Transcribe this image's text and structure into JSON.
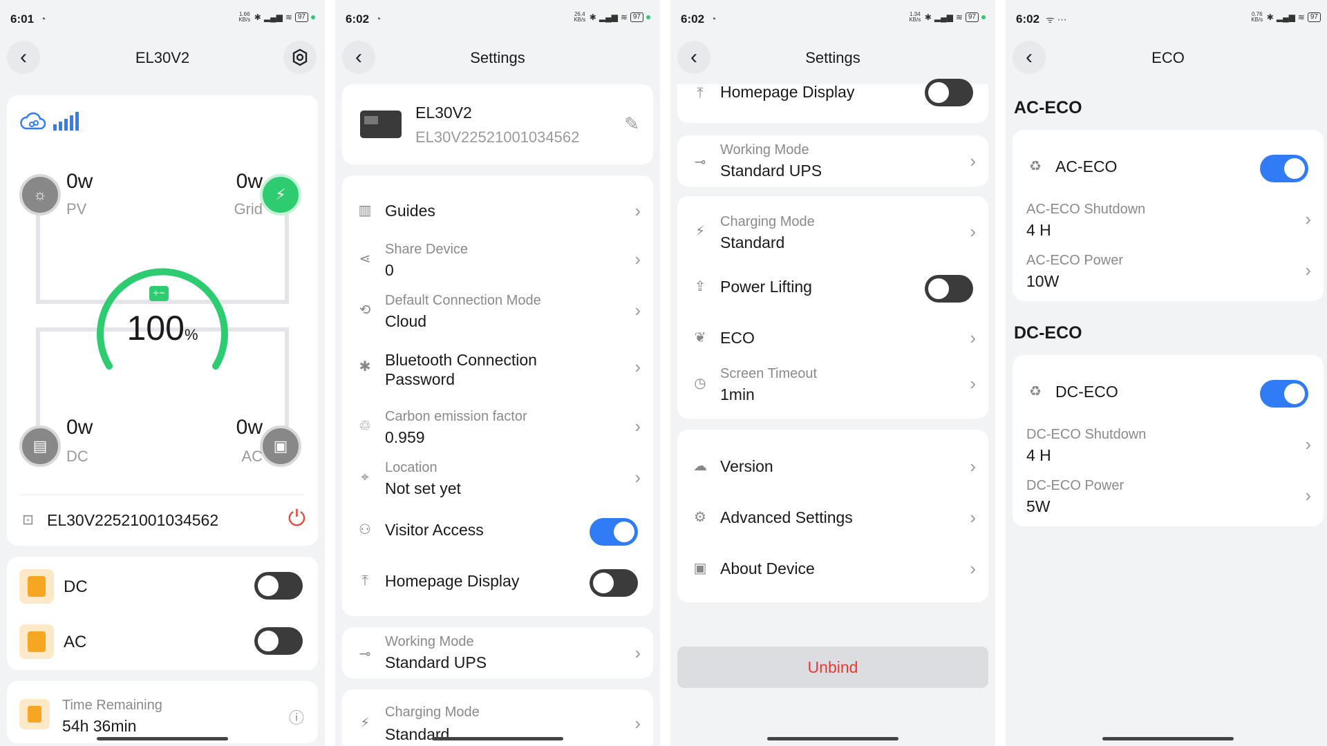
{
  "screens": {
    "s1": {
      "status": {
        "time": "6:01",
        "speed": "1.66\nKB/s",
        "battery": "97"
      },
      "title": "EL30V2",
      "pv": {
        "value": "0w",
        "label": "PV"
      },
      "grid": {
        "value": "0w",
        "label": "Grid"
      },
      "dc_power": {
        "value": "0w",
        "label": "DC"
      },
      "ac_power": {
        "value": "0w",
        "label": "AC"
      },
      "battery_percent": "100",
      "battery_unit": "%",
      "battery_level": 1.0,
      "serial": "EL30V22521001034562",
      "dc_label": "DC",
      "ac_label": "AC",
      "dc_on": false,
      "ac_on": false,
      "time_remaining_label": "Time Remaining",
      "time_remaining_value": "54h 36min"
    },
    "s2": {
      "status": {
        "time": "6:02",
        "speed": "26.4\nKB/s",
        "battery": "97"
      },
      "title": "Settings",
      "device_name": "EL30V2",
      "device_serial": "EL30V22521001034562",
      "guides": "Guides",
      "share_device_label": "Share Device",
      "share_device_value": "0",
      "default_conn_label": "Default Connection Mode",
      "default_conn_value": "Cloud",
      "bt_password_l1": "Bluetooth Connection",
      "bt_password_l2": "Password",
      "carbon_label": "Carbon emission factor",
      "carbon_value": "0.959",
      "location_label": "Location",
      "location_value": "Not set yet",
      "visitor_access": "Visitor Access",
      "visitor_on": true,
      "homepage_display": "Homepage Display",
      "homepage_on": false,
      "working_mode_label": "Working Mode",
      "working_mode_value": "Standard UPS",
      "charging_mode_label": "Charging Mode",
      "charging_mode_value": "Standard"
    },
    "s3": {
      "status": {
        "time": "6:02",
        "speed": "1.34\nKB/s",
        "battery": "97"
      },
      "title": "Settings",
      "homepage_display": "Homepage Display",
      "working_mode_label": "Working Mode",
      "working_mode_value": "Standard UPS",
      "charging_mode_label": "Charging Mode",
      "charging_mode_value": "Standard",
      "power_lifting": "Power Lifting",
      "power_lifting_on": false,
      "eco": "ECO",
      "screen_timeout_label": "Screen Timeout",
      "screen_timeout_value": "1min",
      "version": "Version",
      "advanced_settings": "Advanced Settings",
      "about_device": "About Device",
      "unbind": "Unbind"
    },
    "s4": {
      "status": {
        "time": "6:02",
        "speed": "0.76\nKB/s",
        "battery": "97"
      },
      "title": "ECO",
      "ac_section": "AC-ECO",
      "ac_eco": "AC-ECO",
      "ac_eco_on": true,
      "ac_shutdown_label": "AC-ECO Shutdown",
      "ac_shutdown_value": "4 H",
      "ac_power_label": "AC-ECO Power",
      "ac_power_value": "10W",
      "dc_section": "DC-ECO",
      "dc_eco": "DC-ECO",
      "dc_eco_on": true,
      "dc_shutdown_label": "DC-ECO Shutdown",
      "dc_shutdown_value": "4 H",
      "dc_power_label": "DC-ECO Power",
      "dc_power_value": "5W"
    }
  },
  "colors": {
    "accent": "#2f7cf6",
    "grid_green": "#2ecc71",
    "power_red": "#e74c3c",
    "unbind_red": "#e53935",
    "orange": "#f5a623"
  }
}
